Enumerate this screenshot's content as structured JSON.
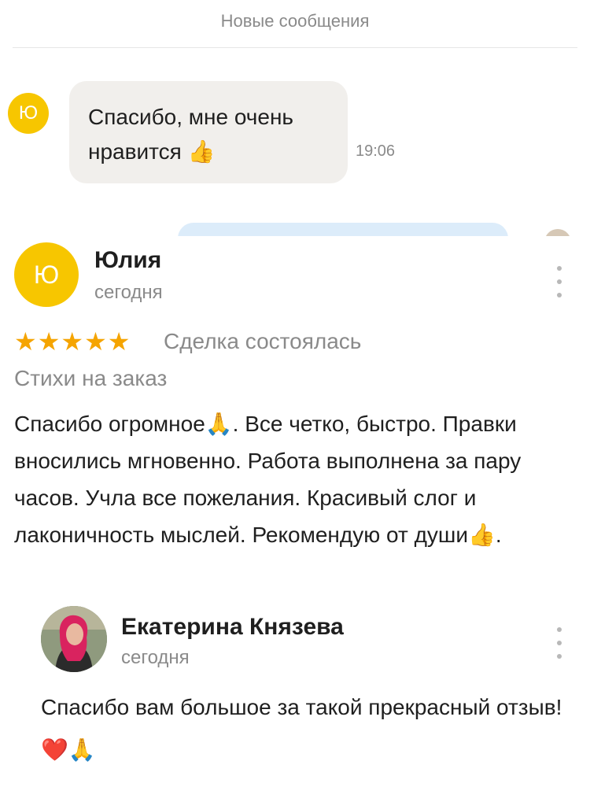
{
  "chat": {
    "header": "Новые сообщения",
    "avatar_initial": "Ю",
    "message_line1": "Спасибо, мне очень",
    "message_line2": "нравится",
    "thumbs_emoji": "👍",
    "time": "19:06"
  },
  "review": {
    "author_initial": "Ю",
    "author_name": "Юлия",
    "date": "сегодня",
    "rating": 5,
    "star_glyph": "★",
    "star_color": "#f5a400",
    "deal_status": "Сделка состоялась",
    "category": "Стихи на заказ",
    "text_part1": "Спасибо огромное",
    "pray_emoji": "🙏",
    "text_part2": ". Все четко, быстро. Правки вносились мгновенно. Работа выполнена за пару часов. Учла все пожелания. Красивый слог и лаконичность мыслей. Рекомендую от души",
    "thumbs_emoji": "👍",
    "text_part3": "."
  },
  "reply": {
    "author_name": "Екатерина Князева",
    "date": "сегодня",
    "text": "Спасибо вам большое за такой прекрасный отзыв!",
    "heart_emoji": "❤️",
    "pray_emoji": "🙏"
  },
  "colors": {
    "avatar_yellow": "#f7c600",
    "bubble_bg": "#f1efec",
    "muted_text": "#8a8a8a"
  }
}
